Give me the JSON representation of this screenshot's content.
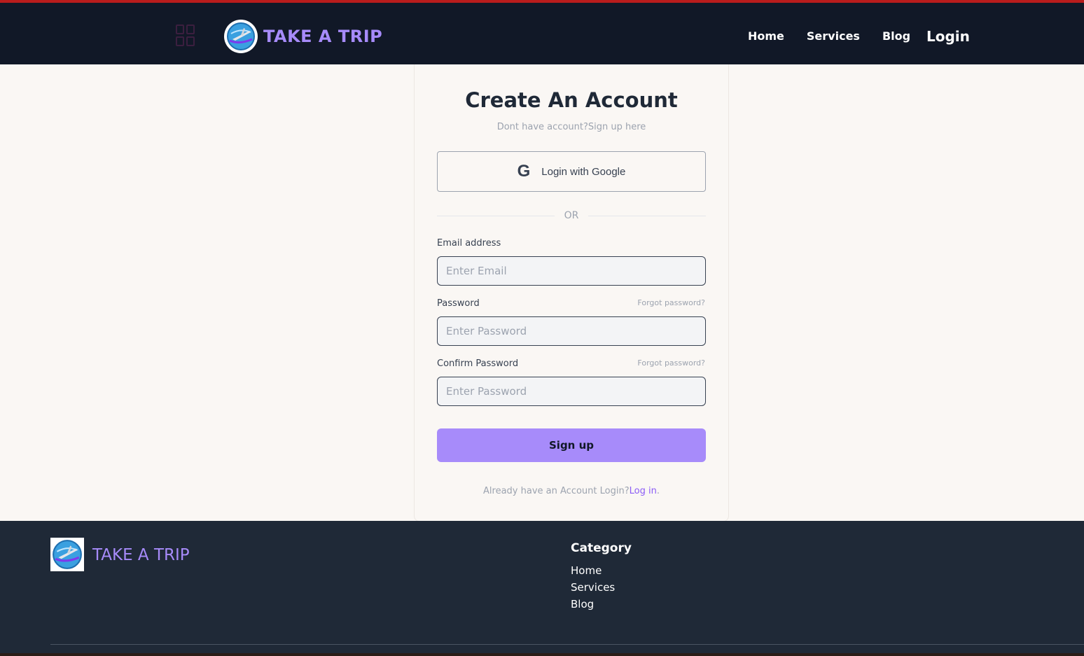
{
  "header": {
    "brand_name": "TAKE A TRIP",
    "nav": [
      "Home",
      "Services",
      "Blog"
    ],
    "login_label": "Login"
  },
  "form": {
    "title": "Create An Account",
    "subtitle": "Dont have account?Sign up here",
    "google_label": "Login with Google",
    "or_label": "OR",
    "email_label": "Email address",
    "email_placeholder": "Enter Email",
    "password_label": "Password",
    "password_placeholder": "Enter Password",
    "forgot_label": "Forgot password?",
    "confirm_label": "Confirm Password",
    "confirm_placeholder": "Enter Password",
    "signup_label": "Sign up",
    "already_text": "Already have an Account Login?",
    "login_link": "Log in",
    "login_suffix": "."
  },
  "footer": {
    "brand_name": "TAKE A TRIP",
    "category_title": "Category",
    "links": [
      "Home",
      "Services",
      "Blog"
    ]
  },
  "icons": {
    "menu": "grid-menu-icon",
    "logo": "globe-airplane-logo",
    "google": "google-g-icon"
  },
  "colors": {
    "accent": "#a78bfa",
    "header_bg": "#111827",
    "footer_bg": "#1f2937",
    "page_bg": "#faf7f4",
    "top_border": "#b91c1c"
  }
}
